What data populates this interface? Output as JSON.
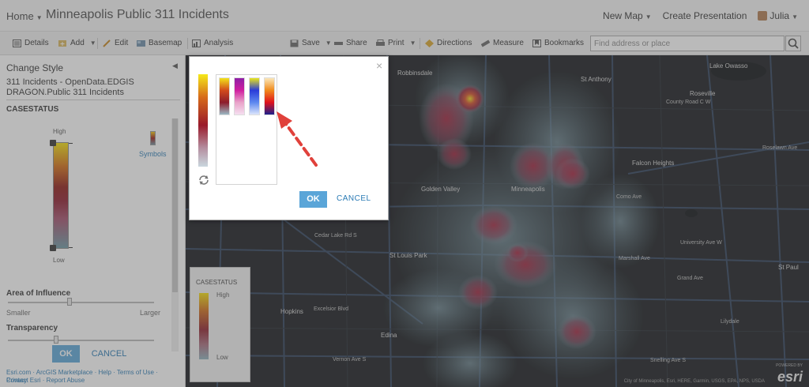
{
  "header": {
    "home": "Home",
    "title": "Minneapolis Public 311 Incidents",
    "new_map": "New Map",
    "create_presentation": "Create Presentation",
    "user": "Julia"
  },
  "toolbar": {
    "details": "Details",
    "add": "Add",
    "edit": "Edit",
    "basemap": "Basemap",
    "analysis": "Analysis",
    "save": "Save",
    "share": "Share",
    "print": "Print",
    "directions": "Directions",
    "measure": "Measure",
    "bookmarks": "Bookmarks",
    "search_placeholder": "Find address or place"
  },
  "panel": {
    "title": "Change Style",
    "layer_name": "311 Incidents - OpenData.EDGIS DRAGON.Public 311 Incidents",
    "field": "CASESTATUS",
    "high": "High",
    "low": "Low",
    "symbols": "Symbols",
    "area_of_influence": "Area of Influence",
    "smaller": "Smaller",
    "larger": "Larger",
    "area_value": 0.42,
    "transparency": "Transparency",
    "transparency_value": 0.33,
    "ok": "OK",
    "cancel": "CANCEL",
    "footer_line1": "Esri.com · ArcGIS Marketplace · Help · Terms of Use · Privacy",
    "footer_line2": "Contact Esri · Report Abuse"
  },
  "legend": {
    "title": "CASESTATUS",
    "high": "High",
    "low": "Low"
  },
  "dialog": {
    "close": "×",
    "ok": "OK",
    "cancel": "CANCEL",
    "ramps": [
      {
        "name": "yellow-red-teal",
        "colors": [
          "#f2e21a",
          "#d24a1c",
          "#8c1c2b",
          "#9ab8c4"
        ]
      },
      {
        "name": "purple-magenta",
        "colors": [
          "#8e1fa6",
          "#d01fa0",
          "#e9a3c9",
          "#f5dff0"
        ]
      },
      {
        "name": "yellow-blue",
        "colors": [
          "#e8e51c",
          "#2a3bd9",
          "#5d88ef",
          "#dbe4fb"
        ]
      },
      {
        "name": "yellow-red-navy",
        "colors": [
          "#fbe7b8",
          "#f08a1c",
          "#e0111c",
          "#1c1f8c"
        ]
      }
    ]
  },
  "map": {
    "labels": [
      "Robbinsdale",
      "St Anthony",
      "Roseville",
      "County Road C W",
      "Lake Owasso",
      "Falcon Heights",
      "Minneapolis",
      "Golden Valley",
      "University Ave W",
      "Marshall Ave",
      "Grand Ave",
      "St Louis Park",
      "Cedar Lake Rd S",
      "Hopkins",
      "Excelsior Blvd",
      "Edina",
      "Vernon Ave S",
      "St Paul",
      "Lilydale",
      "Snelling Ave S",
      "Roselawn Ave",
      "Como Ave"
    ],
    "attribution": "City of Minneapolis, Esri, HERE, Garmin, USGS, EPA, NPS, USDA",
    "esri_powered": "POWERED BY",
    "esri": "esri"
  },
  "colors": {
    "accent": "#5aa5d8",
    "link": "#2a7bb5",
    "arrow": "#e0413b",
    "heat_hot": "#f2d81b",
    "heat_mid": "#a01c2e"
  }
}
